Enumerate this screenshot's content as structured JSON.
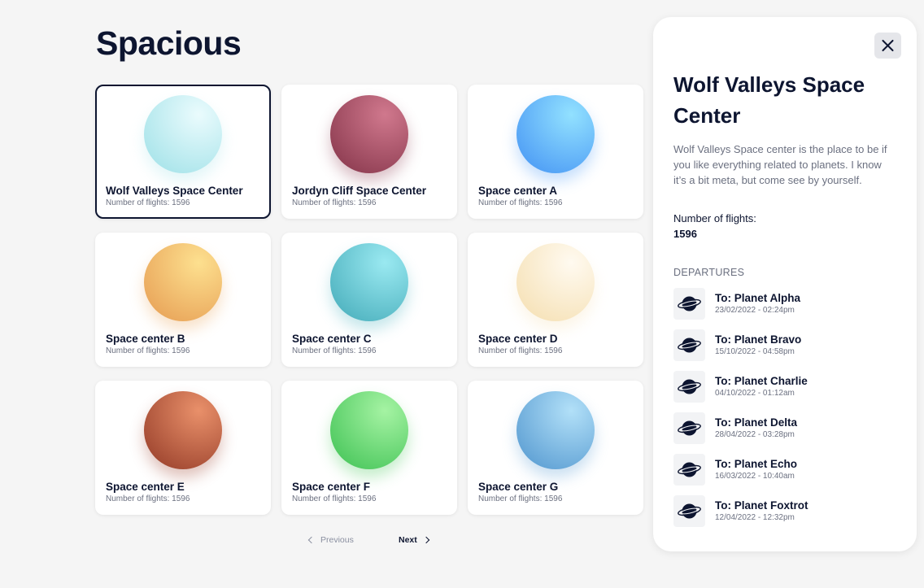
{
  "app": {
    "title": "Spacious"
  },
  "centers": [
    {
      "name": "Wolf Valleys Space Center",
      "flights": "Number of flights: 1596",
      "planet": "icy-planet",
      "color_light": "#eafbfd",
      "color_dark": "#a8e4ea",
      "selected": true
    },
    {
      "name": "Jordyn Cliff Space Center",
      "flights": "Number of flights: 1596",
      "planet": "rose-planet",
      "color_light": "#d0788d",
      "color_dark": "#8e3d52",
      "selected": false
    },
    {
      "name": "Space center A",
      "flights": "Number of flights: 1596",
      "planet": "blue-planet",
      "color_light": "#92e1ff",
      "color_dark": "#4e9df5",
      "selected": false
    },
    {
      "name": "Space center B",
      "flights": "Number of flights: 1596",
      "planet": "orange-planet",
      "color_light": "#fde08f",
      "color_dark": "#e9a55a",
      "selected": false
    },
    {
      "name": "Space center C",
      "flights": "Number of flights: 1596",
      "planet": "teal-planet",
      "color_light": "#9ae9f1",
      "color_dark": "#4fb3c0",
      "selected": false
    },
    {
      "name": "Space center D",
      "flights": "Number of flights: 1596",
      "planet": "cream-planet",
      "color_light": "#fffaf0",
      "color_dark": "#f6e2b8",
      "selected": false
    },
    {
      "name": "Space center E",
      "flights": "Number of flights: 1596",
      "planet": "rust-planet",
      "color_light": "#e9906a",
      "color_dark": "#9f4630",
      "selected": false
    },
    {
      "name": "Space center F",
      "flights": "Number of flights: 1596",
      "planet": "green-planet",
      "color_light": "#a5f3a3",
      "color_dark": "#4cc85e",
      "selected": false
    },
    {
      "name": "Space center G",
      "flights": "Number of flights: 1596",
      "planet": "sky-planet",
      "color_light": "#b2e0f8",
      "color_dark": "#5ea0d4",
      "selected": false
    }
  ],
  "pagination": {
    "previous": "Previous",
    "next": "Next"
  },
  "detail": {
    "title": "Wolf Valleys Space Center",
    "description": "Wolf Valleys Space center is the place to be if you like everything related to planets. I know it’s a bit meta, but come see by yourself.",
    "flights_label": "Number of flights:",
    "flights_value": "1596",
    "departures_header": "DEPARTURES",
    "departures": [
      {
        "to": "To: Planet Alpha",
        "date": "23/02/2022 - 02:24pm",
        "icon": "planet-icon"
      },
      {
        "to": "To: Planet Bravo",
        "date": "15/10/2022 - 04:58pm",
        "icon": "planet-icon"
      },
      {
        "to": "To: Planet Charlie",
        "date": "04/10/2022 - 01:12am",
        "icon": "planet-icon"
      },
      {
        "to": "To: Planet Delta",
        "date": "28/04/2022 - 03:28pm",
        "icon": "planet-icon"
      },
      {
        "to": "To: Planet Echo",
        "date": "16/03/2022 - 10:40am",
        "icon": "planet-icon"
      },
      {
        "to": "To: Planet Foxtrot",
        "date": "12/04/2022 - 12:32pm",
        "icon": "planet-icon"
      }
    ]
  },
  "icons": {
    "close": "close-icon",
    "previous": "chevron-left-icon",
    "next": "chevron-right-icon"
  }
}
